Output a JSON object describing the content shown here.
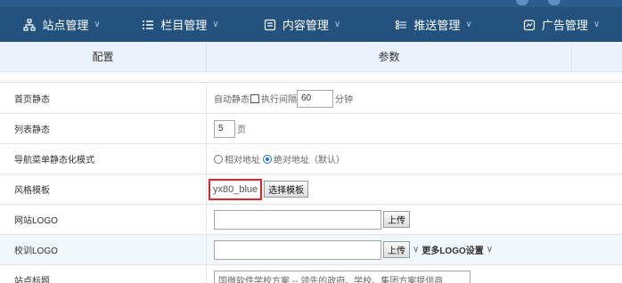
{
  "nav": {
    "items": [
      {
        "label": "站点管理",
        "icon": "sitemap-icon"
      },
      {
        "label": "栏目管理",
        "icon": "list-icon"
      },
      {
        "label": "内容管理",
        "icon": "content-icon"
      },
      {
        "label": "推送管理",
        "icon": "push-icon"
      },
      {
        "label": "广告管理",
        "icon": "ad-icon"
      }
    ],
    "chevron": "∨"
  },
  "table": {
    "col_config": "配置",
    "col_params": "参数"
  },
  "rows": {
    "homepage_static": {
      "label": "首页静态",
      "auto_static": "自动静态",
      "interval_label": "执行间隔",
      "interval_value": "60",
      "unit": "分钟"
    },
    "list_static": {
      "label": "列表静态",
      "value": "5",
      "unit": "页"
    },
    "nav_mode": {
      "label": "导航菜单静态化模式",
      "opt_relative": "相对地址",
      "opt_absolute": "绝对地址（默认）",
      "selected": "absolute"
    },
    "template": {
      "label": "风格模板",
      "value": "yx80_blue",
      "button": "选择模板"
    },
    "site_logo": {
      "label": "网站LOGO",
      "value": "",
      "button": "上传"
    },
    "school_logo": {
      "label": "校训LOGO",
      "value": "",
      "button": "上传",
      "more": "更多LOGO设置"
    },
    "site_title": {
      "label": "站点标题",
      "value": "国微软件学校方案 -- 领先的政府、学校、集团方案提供商"
    }
  },
  "colors": {
    "nav_bg": "#23527e",
    "header_bg": "#eaf3fb",
    "highlight": "#e3252a",
    "alt_row": "#f1f7fb"
  }
}
